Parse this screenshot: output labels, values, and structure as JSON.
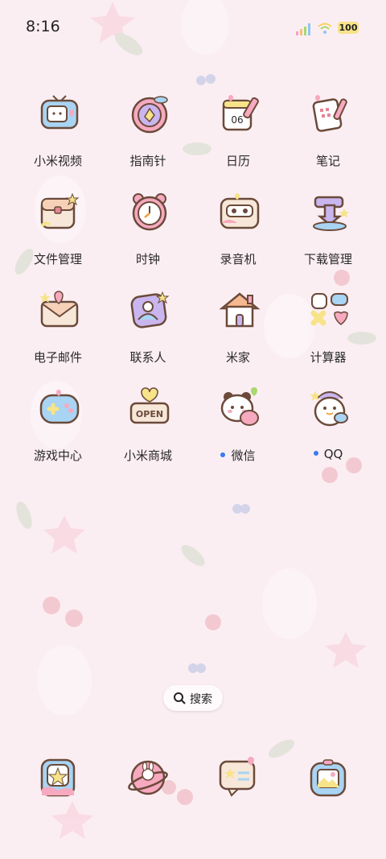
{
  "status_bar": {
    "time": "8:16",
    "battery": "100",
    "signal_icon": "signal-bars-icon",
    "wifi_icon": "wifi-icon"
  },
  "apps": [
    {
      "label": "小米视频",
      "icon": "tv-icon",
      "notify": false
    },
    {
      "label": "指南针",
      "icon": "compass-icon",
      "notify": false
    },
    {
      "label": "日历",
      "icon": "calendar-icon",
      "notify": false,
      "badge_text": "06"
    },
    {
      "label": "笔记",
      "icon": "notes-icon",
      "notify": false
    },
    {
      "label": "文件管理",
      "icon": "folder-bag-icon",
      "notify": false
    },
    {
      "label": "时钟",
      "icon": "alarm-clock-icon",
      "notify": false
    },
    {
      "label": "录音机",
      "icon": "cassette-icon",
      "notify": false
    },
    {
      "label": "下载管理",
      "icon": "download-icon",
      "notify": false
    },
    {
      "label": "电子邮件",
      "icon": "envelope-icon",
      "notify": false
    },
    {
      "label": "联系人",
      "icon": "contacts-icon",
      "notify": false
    },
    {
      "label": "米家",
      "icon": "house-icon",
      "notify": false
    },
    {
      "label": "计算器",
      "icon": "calculator-icon",
      "notify": false
    },
    {
      "label": "游戏中心",
      "icon": "gamepad-icon",
      "notify": false
    },
    {
      "label": "小米商城",
      "icon": "open-sign-icon",
      "notify": false,
      "badge_text": "OPEN"
    },
    {
      "label": "微信",
      "icon": "wechat-bear-icon",
      "notify": true
    },
    {
      "label": "QQ",
      "icon": "qq-penguin-icon",
      "notify": true
    }
  ],
  "search": {
    "label": "搜索",
    "icon": "search-icon"
  },
  "dock": [
    {
      "icon": "phone-frame-icon"
    },
    {
      "icon": "planet-bunny-icon"
    },
    {
      "icon": "message-star-icon"
    },
    {
      "icon": "gallery-icon"
    }
  ],
  "colors": {
    "background": "#fbeef3",
    "outline": "#6b4a3a",
    "notify_dot": "#3a7bf0",
    "pink": "#f6a9bf",
    "blue": "#a9d4f3",
    "yellow": "#f7e389",
    "purple": "#c9b6ef"
  }
}
